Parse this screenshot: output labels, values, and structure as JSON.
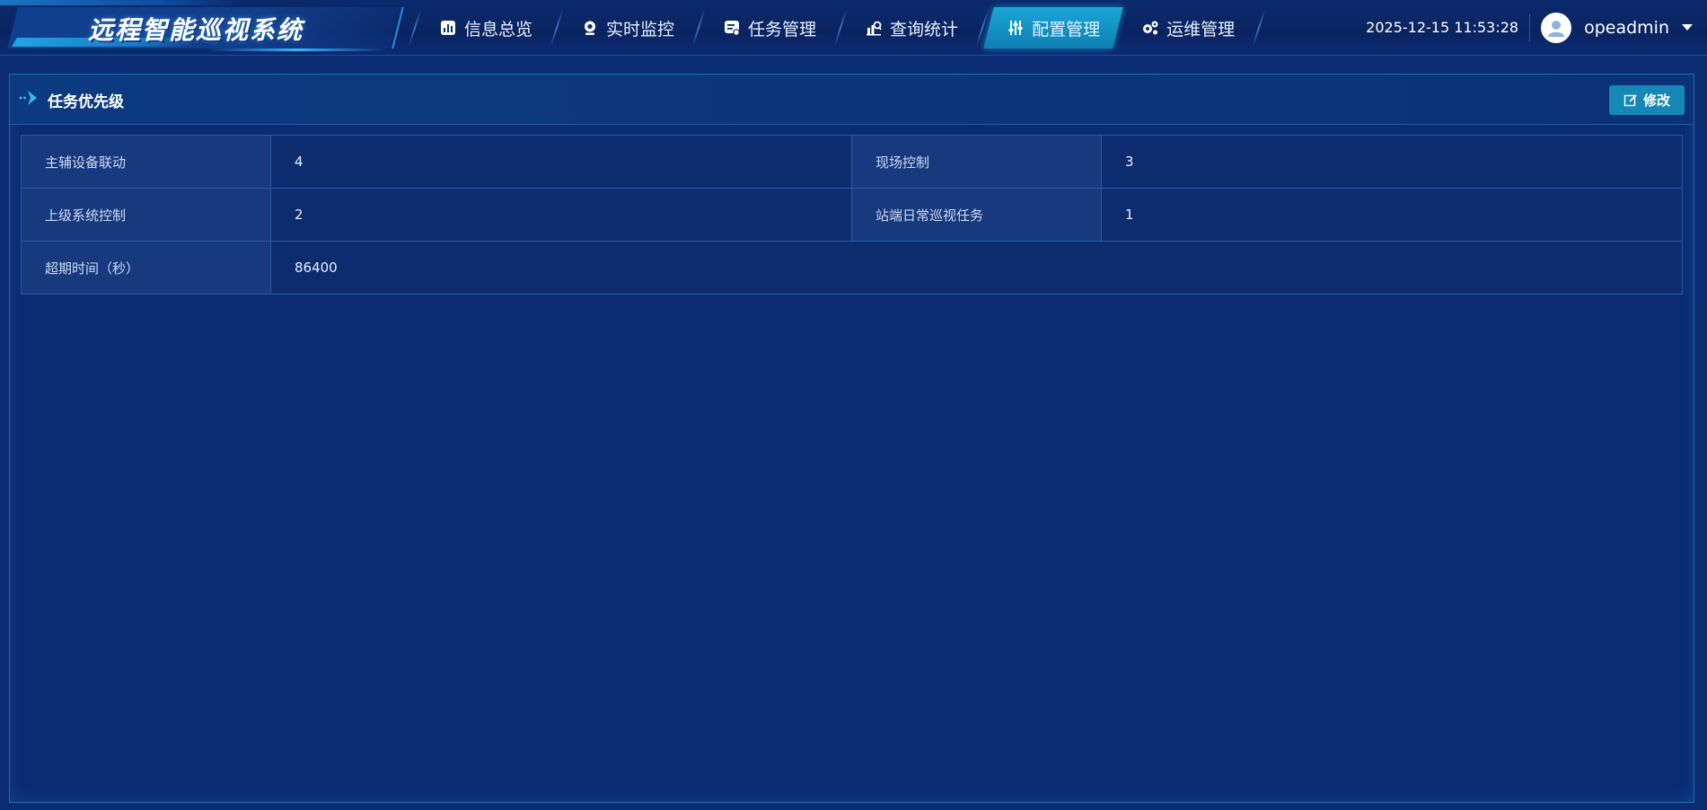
{
  "app": {
    "title": "远程智能巡视系统"
  },
  "nav": {
    "items": [
      {
        "label": "信息总览",
        "icon": "bar-chart-icon",
        "active": false
      },
      {
        "label": "实时监控",
        "icon": "webcam-icon",
        "active": false
      },
      {
        "label": "任务管理",
        "icon": "task-list-icon",
        "active": false
      },
      {
        "label": "查询统计",
        "icon": "stats-search-icon",
        "active": false
      },
      {
        "label": "配置管理",
        "icon": "sliders-icon",
        "active": true
      },
      {
        "label": "运维管理",
        "icon": "gears-icon",
        "active": false
      }
    ]
  },
  "header": {
    "datetime": "2025-12-15 11:53:28",
    "username": "opeadmin"
  },
  "panel": {
    "title": "任务优先级",
    "edit_label": "修改",
    "rows": [
      {
        "label1": "主辅设备联动",
        "value1": "4",
        "label2": "现场控制",
        "value2": "3"
      },
      {
        "label1": "上级系统控制",
        "value1": "2",
        "label2": "站端日常巡视任务",
        "value2": "1"
      },
      {
        "label1": "超期时间（秒）",
        "value1": "86400"
      }
    ]
  },
  "colors": {
    "background": "#0b2b72",
    "accent": "#1588b8",
    "active_tab": "#1aa6d6"
  }
}
